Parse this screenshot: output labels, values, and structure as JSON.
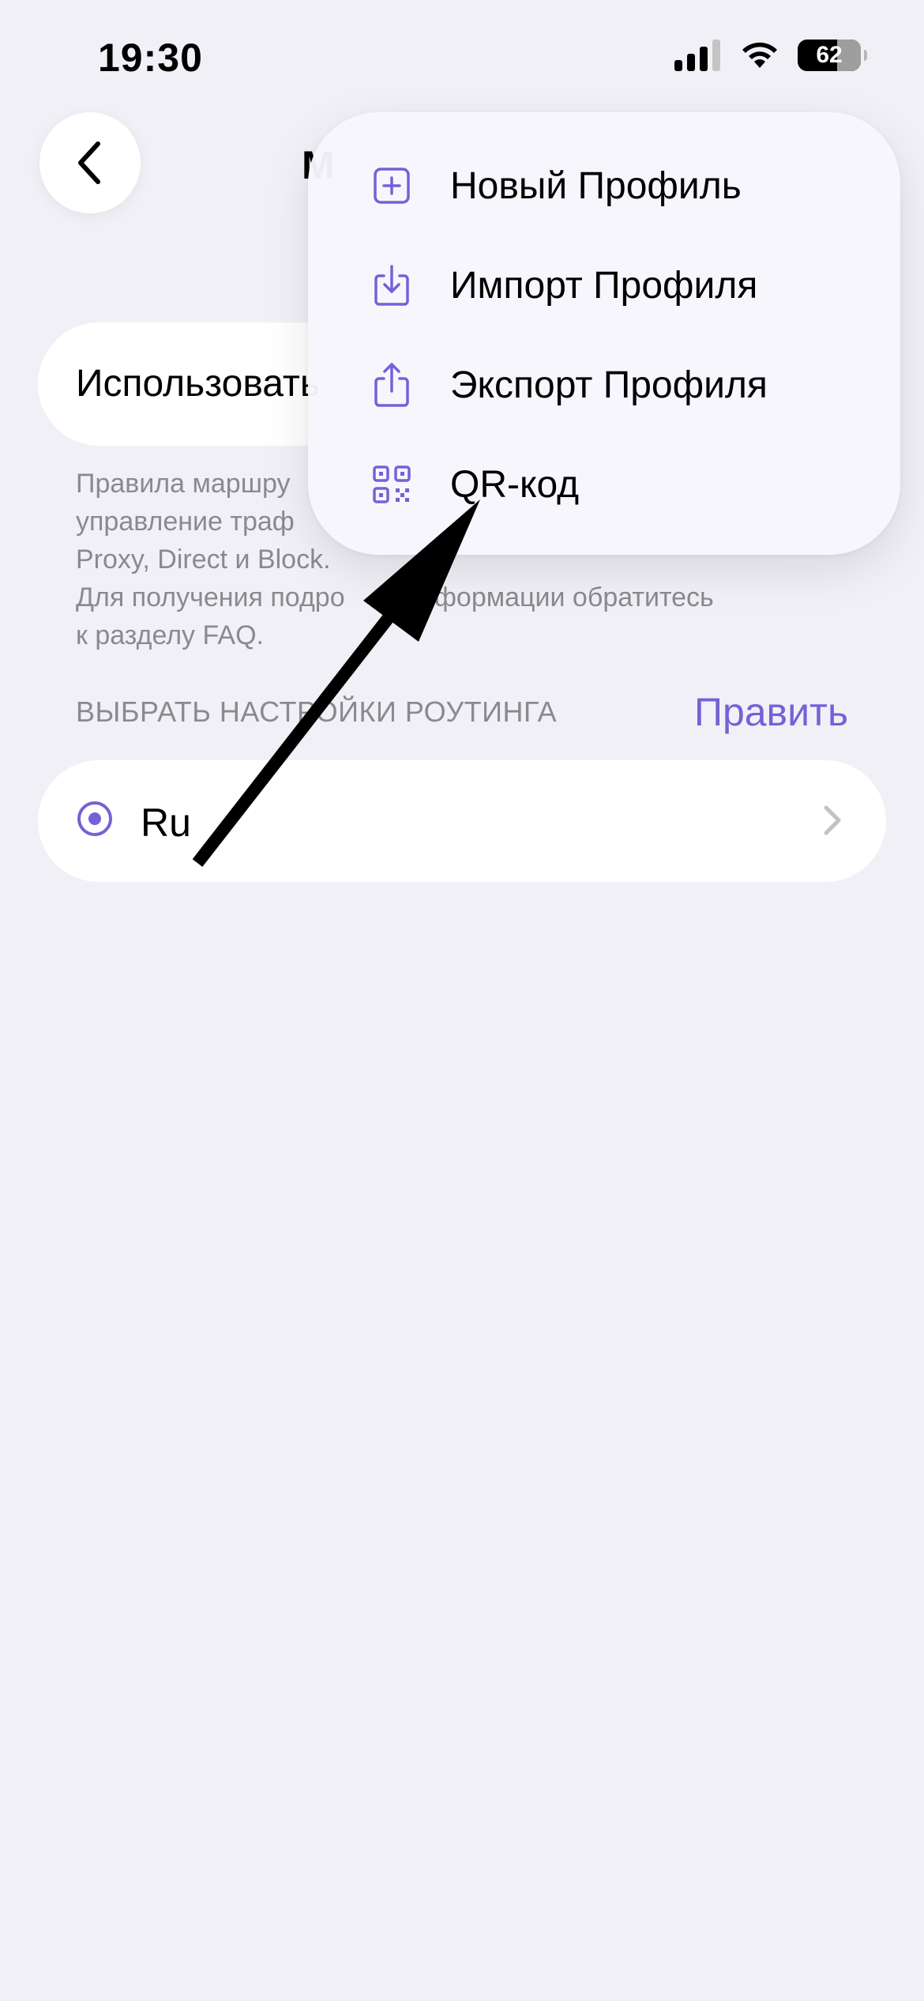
{
  "status_bar": {
    "time": "19:30",
    "battery": "62",
    "icons": [
      "signal-icon",
      "wifi-icon",
      "battery-icon"
    ]
  },
  "header": {
    "back_icon": "chevron-left-icon",
    "title_visible": "M"
  },
  "toggle": {
    "label": "Использовать"
  },
  "description": {
    "lines": [
      "Правила маршру",
      "управление траф",
      "Proxy, Direct и Block.",
      "Для получения подро        информации обратитесь",
      "к разделу FAQ."
    ]
  },
  "routing": {
    "section_header": "ВЫБРАТЬ НАСТРОЙКИ РОУТИНГА",
    "edit_label": "Править",
    "profile_name": "Ru"
  },
  "menu": {
    "items": [
      {
        "label": "Новый Профиль",
        "icon": "plus-square-icon"
      },
      {
        "label": "Импорт Профиля",
        "icon": "import-icon"
      },
      {
        "label": "Экспорт Профиля",
        "icon": "share-icon"
      },
      {
        "label": "QR-код",
        "icon": "qr-code-icon"
      }
    ]
  },
  "colors": {
    "accent": "#7561d6",
    "background": "#f2f0f7",
    "secondary_text": "#8a8a8e"
  }
}
